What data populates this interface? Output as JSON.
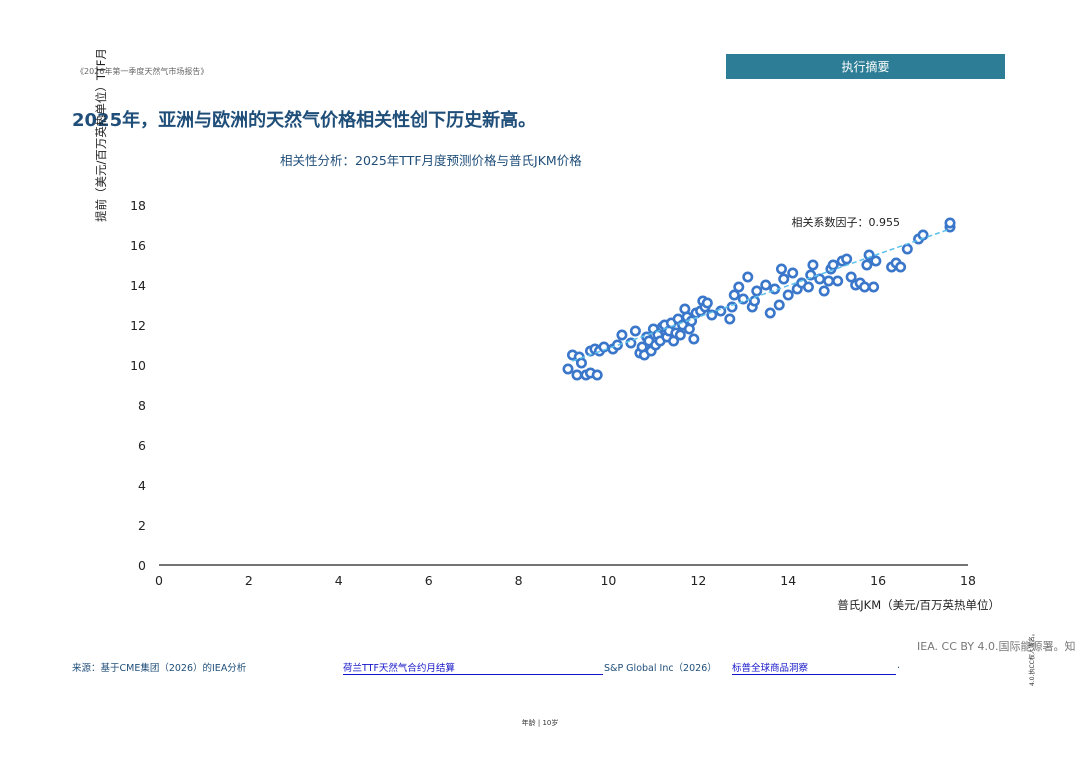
{
  "header": {
    "report_title": "《2026年第一季度天然气市场报告》",
    "section_tab": "执行摘要"
  },
  "headline": "2025年，亚洲与欧洲的天然气价格相关性创下历史新高。",
  "chart_data": {
    "type": "scatter",
    "title": "相关性分析：2025年TTF月度预测价格与普氏JKM价格",
    "xlabel": "普氏JKM（美元/百万英热单位）",
    "ylabel": "提前（美元/百万英热单位）TTF月",
    "xlim": [
      0,
      18
    ],
    "ylim": [
      0,
      18
    ],
    "xticks": [
      0,
      2,
      4,
      6,
      8,
      10,
      12,
      14,
      16,
      18
    ],
    "yticks": [
      0,
      2,
      4,
      6,
      8,
      10,
      12,
      14,
      16,
      18
    ],
    "annotation": "相关系数因子：0.955",
    "marker_color": "#3a76c9",
    "trend_color": "#5bc0eb",
    "grid": false,
    "points": [
      [
        9.1,
        9.8
      ],
      [
        9.2,
        10.5
      ],
      [
        9.3,
        9.5
      ],
      [
        9.35,
        10.4
      ],
      [
        9.4,
        10.1
      ],
      [
        9.5,
        9.5
      ],
      [
        9.6,
        9.6
      ],
      [
        9.75,
        9.5
      ],
      [
        9.6,
        10.7
      ],
      [
        9.7,
        10.8
      ],
      [
        9.8,
        10.7
      ],
      [
        9.9,
        10.9
      ],
      [
        10.1,
        10.8
      ],
      [
        10.2,
        11.0
      ],
      [
        10.3,
        11.5
      ],
      [
        10.5,
        11.1
      ],
      [
        10.6,
        11.7
      ],
      [
        10.7,
        10.6
      ],
      [
        10.75,
        10.9
      ],
      [
        10.8,
        10.5
      ],
      [
        10.85,
        11.4
      ],
      [
        10.9,
        11.2
      ],
      [
        10.95,
        10.7
      ],
      [
        11.0,
        11.8
      ],
      [
        11.05,
        11.0
      ],
      [
        11.1,
        11.5
      ],
      [
        11.15,
        11.2
      ],
      [
        11.2,
        11.9
      ],
      [
        11.25,
        12.0
      ],
      [
        11.3,
        11.4
      ],
      [
        11.35,
        11.7
      ],
      [
        11.4,
        12.1
      ],
      [
        11.45,
        11.2
      ],
      [
        11.5,
        11.6
      ],
      [
        11.55,
        12.3
      ],
      [
        11.6,
        11.5
      ],
      [
        11.65,
        12.0
      ],
      [
        11.7,
        12.8
      ],
      [
        11.75,
        12.4
      ],
      [
        11.8,
        11.8
      ],
      [
        11.85,
        12.2
      ],
      [
        11.9,
        11.3
      ],
      [
        11.95,
        12.6
      ],
      [
        12.05,
        12.7
      ],
      [
        12.1,
        13.2
      ],
      [
        12.15,
        12.9
      ],
      [
        12.2,
        13.1
      ],
      [
        12.3,
        12.5
      ],
      [
        12.5,
        12.7
      ],
      [
        12.7,
        12.3
      ],
      [
        12.75,
        12.9
      ],
      [
        12.8,
        13.5
      ],
      [
        12.9,
        13.9
      ],
      [
        13.0,
        13.3
      ],
      [
        13.1,
        14.4
      ],
      [
        13.2,
        12.9
      ],
      [
        13.25,
        13.2
      ],
      [
        13.3,
        13.7
      ],
      [
        13.5,
        14.0
      ],
      [
        13.6,
        12.6
      ],
      [
        13.7,
        13.8
      ],
      [
        13.8,
        13.0
      ],
      [
        13.85,
        14.8
      ],
      [
        13.9,
        14.3
      ],
      [
        14.0,
        13.5
      ],
      [
        14.1,
        14.6
      ],
      [
        14.2,
        13.8
      ],
      [
        14.3,
        14.1
      ],
      [
        14.45,
        13.9
      ],
      [
        14.5,
        14.5
      ],
      [
        14.55,
        15.0
      ],
      [
        14.7,
        14.3
      ],
      [
        14.8,
        13.7
      ],
      [
        14.9,
        14.2
      ],
      [
        14.95,
        14.8
      ],
      [
        15.0,
        15.0
      ],
      [
        15.1,
        14.2
      ],
      [
        15.2,
        15.2
      ],
      [
        15.3,
        15.3
      ],
      [
        15.4,
        14.4
      ],
      [
        15.5,
        14.0
      ],
      [
        15.6,
        14.1
      ],
      [
        15.75,
        15.0
      ],
      [
        15.8,
        15.5
      ],
      [
        15.9,
        13.9
      ],
      [
        15.95,
        15.2
      ],
      [
        15.7,
        13.9
      ],
      [
        16.3,
        14.9
      ],
      [
        16.4,
        15.1
      ],
      [
        16.5,
        14.9
      ],
      [
        16.65,
        15.8
      ],
      [
        16.9,
        16.3
      ],
      [
        17.0,
        16.5
      ],
      [
        17.6,
        16.9
      ],
      [
        17.6,
        17.1
      ]
    ],
    "trend": [
      [
        9.2,
        10.2
      ],
      [
        17.6,
        16.8
      ]
    ]
  },
  "footer": {
    "source_label": "来源：基于CME集团（2026）的IEA分析",
    "link1": "荷兰TTF天然气合约月结算",
    "sp_text": "S&P Global Inc（2026）",
    "link2": "标普全球商品洞察",
    "period": ".",
    "license": "IEA. CC BY 4.0.国际能源署。知",
    "license_small": "4.0.执CC权人署名。",
    "page_number": "年龄 | 10岁"
  }
}
